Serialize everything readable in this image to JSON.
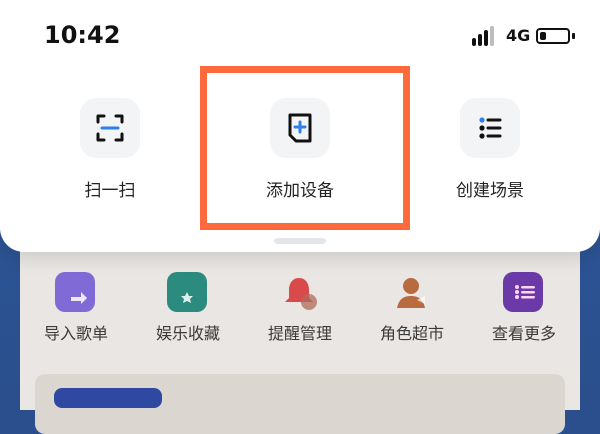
{
  "status_bar": {
    "time": "10:42",
    "network": "4G"
  },
  "sheet": {
    "actions": [
      {
        "label": "扫一扫",
        "icon": "scan-icon"
      },
      {
        "label": "添加设备",
        "icon": "add-device-icon"
      },
      {
        "label": "创建场景",
        "icon": "list-icon"
      }
    ]
  },
  "background": {
    "shortcuts": [
      {
        "label": "导入歌单",
        "icon": "import-playlist-icon"
      },
      {
        "label": "娱乐收藏",
        "icon": "entertainment-favorites-icon"
      },
      {
        "label": "提醒管理",
        "icon": "reminder-bell-icon"
      },
      {
        "label": "角色超市",
        "icon": "character-store-icon"
      },
      {
        "label": "查看更多",
        "icon": "more-list-icon"
      }
    ]
  },
  "colors": {
    "highlight": "#ff6a3d",
    "accent_blue": "#2f80ed"
  }
}
